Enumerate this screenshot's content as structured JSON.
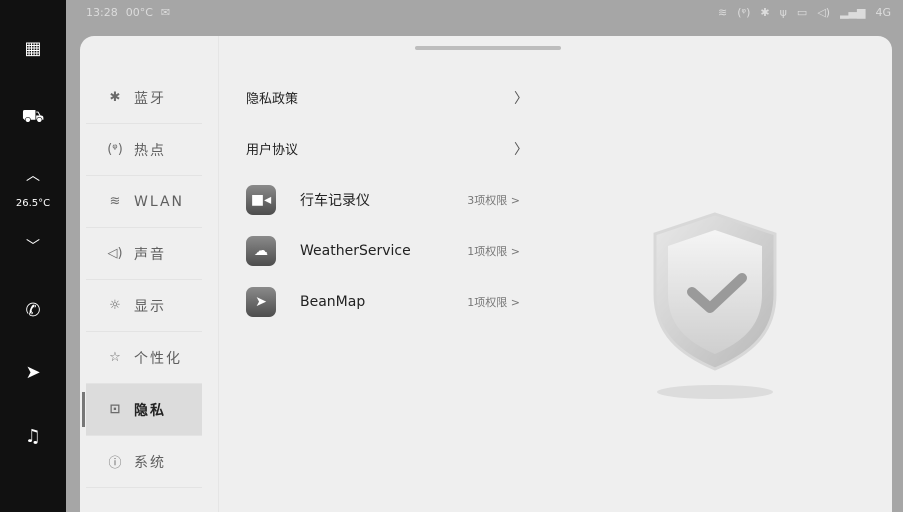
{
  "status": {
    "time": "13:28",
    "temp": "00°C",
    "network": "4G"
  },
  "dock": {
    "temperature": "26.5°C"
  },
  "menu": {
    "items": [
      {
        "icon": "✱",
        "label": "蓝牙"
      },
      {
        "icon": "(ᵠ)",
        "label": "热点"
      },
      {
        "icon": "≋",
        "label": "WLAN"
      },
      {
        "icon": "◁)",
        "label": "声音"
      },
      {
        "icon": "☼",
        "label": "显示"
      },
      {
        "icon": "☆",
        "label": "个性化"
      },
      {
        "icon": "⊡",
        "label": "隐私"
      },
      {
        "icon": "ⓘ",
        "label": "系统"
      }
    ],
    "active_index": 6
  },
  "content": {
    "links": [
      {
        "label": "隐私政策"
      },
      {
        "label": "用户协议"
      }
    ],
    "apps": [
      {
        "name": "行车记录仪",
        "permissions": "3项权限 >",
        "icon": "camera-icon"
      },
      {
        "name": "WeatherService",
        "permissions": "1项权限 >",
        "icon": "cloud-icon"
      },
      {
        "name": "BeanMap",
        "permissions": "1项权限 >",
        "icon": "navigation-icon"
      }
    ]
  }
}
